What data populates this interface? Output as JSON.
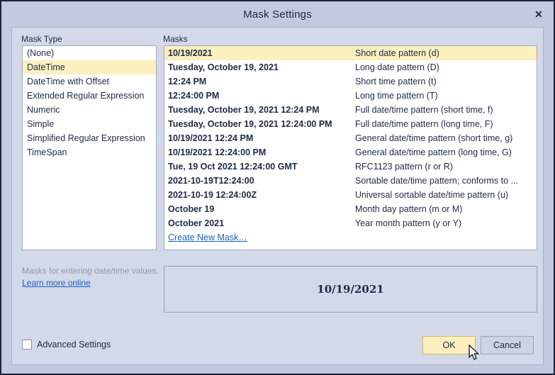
{
  "window": {
    "title": "Mask Settings",
    "close_icon": "close-icon",
    "close_glyph": "✕"
  },
  "mask_type": {
    "label": "Mask Type",
    "items": [
      "(None)",
      "DateTime",
      "DateTime with Offset",
      "Extended Regular Expression",
      "Numeric",
      "Simple",
      "Simplified Regular Expression",
      "TimeSpan"
    ],
    "selected_index": 1
  },
  "hint": {
    "text": "Masks for entering date/time values.",
    "link_label": "Learn more online"
  },
  "masks": {
    "label": "Masks",
    "selected_index": 0,
    "rows": [
      {
        "pattern": "10/19/2021",
        "description": "Short date pattern (d)"
      },
      {
        "pattern": "Tuesday, October 19, 2021",
        "description": "Long date pattern (D)"
      },
      {
        "pattern": "12:24 PM",
        "description": "Short time pattern (t)"
      },
      {
        "pattern": "12:24:00 PM",
        "description": "Long time pattern (T)"
      },
      {
        "pattern": "Tuesday, October 19, 2021 12:24 PM",
        "description": "Full date/time pattern (short time, f)"
      },
      {
        "pattern": "Tuesday, October 19, 2021 12:24:00 PM",
        "description": "Full date/time pattern (long time, F)"
      },
      {
        "pattern": "10/19/2021 12:24 PM",
        "description": "General date/time pattern (short time, g)"
      },
      {
        "pattern": "10/19/2021 12:24:00 PM",
        "description": "General date/time pattern (long time, G)"
      },
      {
        "pattern": "Tue, 19 Oct 2021 12:24:00 GMT",
        "description": "RFC1123 pattern (r or R)"
      },
      {
        "pattern": "2021-10-19T12:24:00",
        "description": "Sortable date/time pattern; conforms to ..."
      },
      {
        "pattern": "2021-10-19 12:24:00Z",
        "description": "Universal sortable date/time pattern (u)"
      },
      {
        "pattern": "October 19",
        "description": "Month day pattern (m or M)"
      },
      {
        "pattern": "October 2021",
        "description": "Year month pattern (y or Y)"
      }
    ],
    "create_new_label": "Create New Mask…"
  },
  "preview": {
    "value": "10/19/2021"
  },
  "advanced": {
    "label": "Advanced Settings",
    "checked": false
  },
  "buttons": {
    "ok_label": "OK",
    "cancel_label": "Cancel",
    "ok_hovered": true
  },
  "colors": {
    "dialog_background": "#c3cae0",
    "panel_background": "#d3d9e9",
    "list_background": "#ffffff",
    "selection_highlight": "#fdf0bf",
    "text": "#1f2a44",
    "link": "#1d5fbf",
    "hint_text": "#8f97ab",
    "border": "#a0a8bd",
    "outer_frame": "#1b2439"
  }
}
